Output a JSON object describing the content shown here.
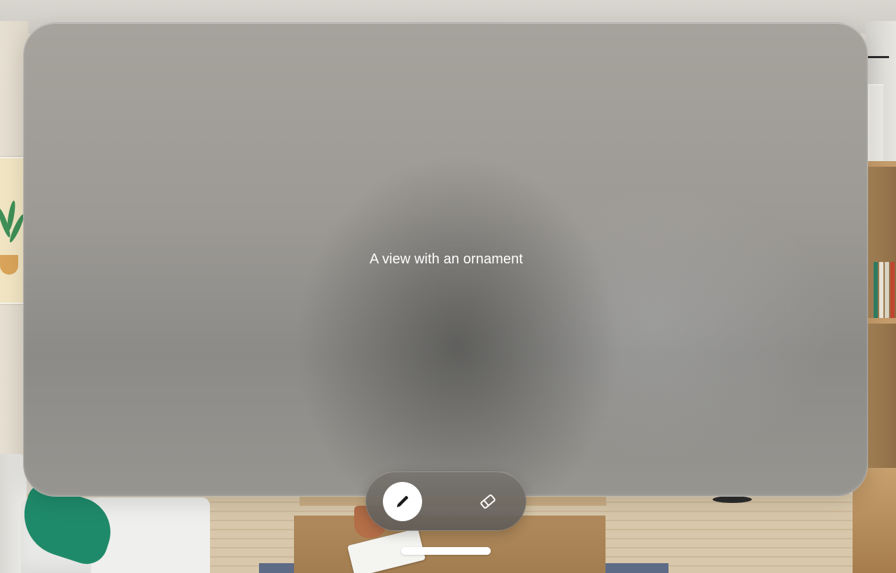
{
  "window": {
    "title": "A view with an ornament"
  },
  "ornament": {
    "tools": [
      {
        "icon": "pencil-icon",
        "selected": true
      },
      {
        "icon": "eraser-icon",
        "selected": false
      }
    ]
  },
  "colors": {
    "selected_tool_bg": "#ffffff",
    "title_text": "#ffffff"
  }
}
